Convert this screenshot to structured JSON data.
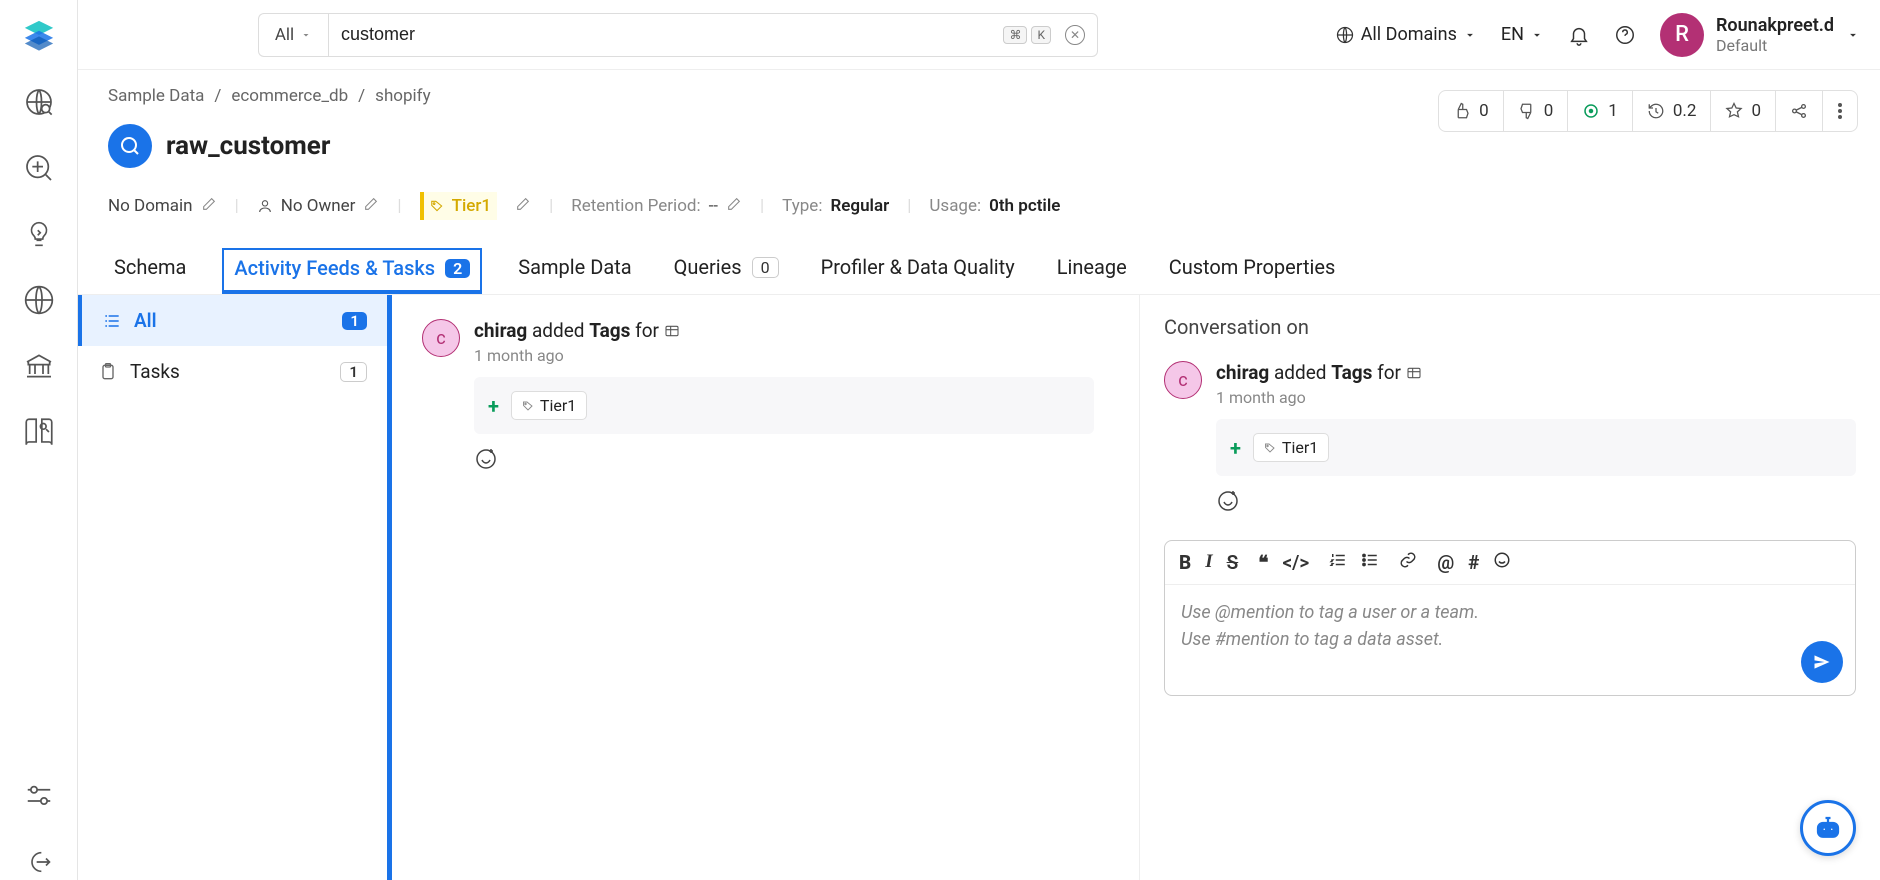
{
  "search": {
    "scope": "All",
    "value": "customer",
    "kbd1": "⌘",
    "kbd2": "K"
  },
  "topRight": {
    "domains": "All Domains",
    "lang": "EN",
    "user_initial": "R",
    "user_name": "Rounakpreet.d",
    "user_role": "Default"
  },
  "breadcrumb": [
    "Sample Data",
    "ecommerce_db",
    "shopify"
  ],
  "title": "raw_customer",
  "meta": {
    "domain": "No Domain",
    "owner": "No Owner",
    "tier": "Tier1",
    "retention_label": "Retention Period:",
    "retention_value": "--",
    "type_label": "Type:",
    "type_value": "Regular",
    "usage_label": "Usage:",
    "usage_value": "0th pctile"
  },
  "actions": {
    "upvotes": "0",
    "downvotes": "0",
    "tests": "1",
    "version": "0.2",
    "stars": "0"
  },
  "tabs": [
    {
      "label": "Schema"
    },
    {
      "label": "Activity Feeds & Tasks",
      "badge": "2",
      "active": true
    },
    {
      "label": "Sample Data"
    },
    {
      "label": "Queries",
      "badge_gray": "0"
    },
    {
      "label": "Profiler & Data Quality"
    },
    {
      "label": "Lineage"
    },
    {
      "label": "Custom Properties"
    }
  ],
  "sidenav": {
    "all_label": "All",
    "all_count": "1",
    "tasks_label": "Tasks",
    "tasks_count": "1"
  },
  "feed": {
    "user": "chirag",
    "action": " added ",
    "object": "Tags",
    "suffix": " for ",
    "time": "1 month ago",
    "tag": "Tier1",
    "user_initial": "c"
  },
  "convo": {
    "title": "Conversation on",
    "user": "chirag",
    "action": " added ",
    "object": "Tags",
    "suffix": " for ",
    "time": "1 month ago",
    "tag": "Tier1",
    "user_initial": "c",
    "placeholder_line1": "Use @mention to tag a user or a team.",
    "placeholder_line2": "Use #mention to tag a data asset."
  }
}
